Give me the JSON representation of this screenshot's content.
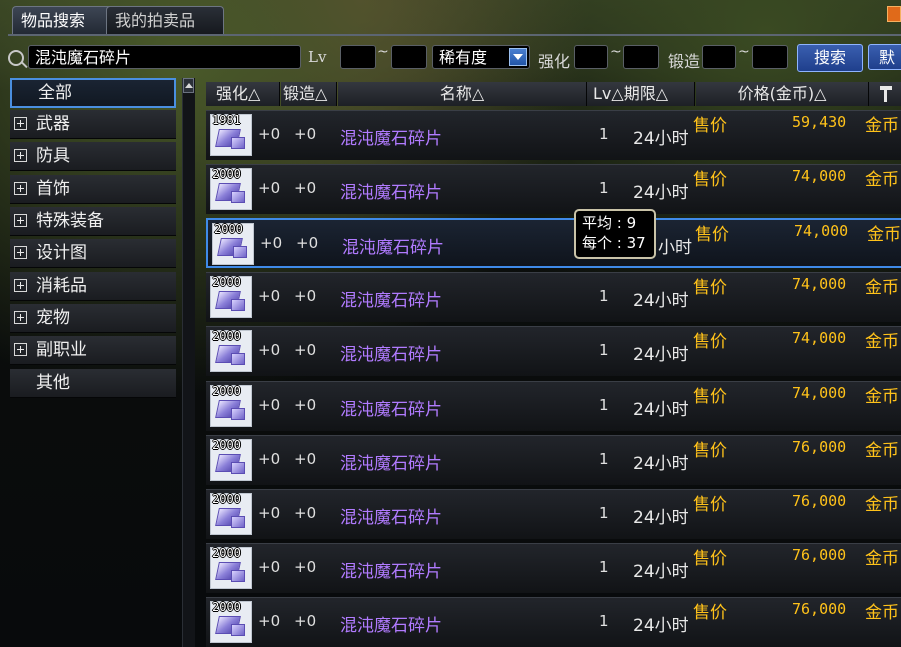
{
  "tabs": {
    "search": "物品搜索",
    "mine": "我的拍卖品"
  },
  "search": {
    "query": "混沌魔石碎片",
    "lv_label": "Lv",
    "tilde": "~",
    "rarity_selected": "稀有度",
    "enhance_label": "强化",
    "forge_label": "锻造",
    "search_button": "搜索",
    "default_button": "默"
  },
  "sidebar": {
    "items": [
      {
        "label": "全部"
      },
      {
        "label": "武器"
      },
      {
        "label": "防具"
      },
      {
        "label": "首饰"
      },
      {
        "label": "特殊装备"
      },
      {
        "label": "设计图"
      },
      {
        "label": "消耗品"
      },
      {
        "label": "宠物"
      },
      {
        "label": "副职业"
      },
      {
        "label": "其他"
      }
    ]
  },
  "table": {
    "headers": {
      "enhance": "强化△",
      "forge": "锻造△",
      "name": "名称△",
      "lv_period": "Lv△期限△",
      "price": "价格(金币)△"
    },
    "rows": [
      {
        "qty": "1981",
        "enhance": "+0",
        "forge": "+0",
        "name": "混沌魔石碎片",
        "lv": "1",
        "period": "24小时",
        "sell": "售价",
        "price": "59,430",
        "currency": "金币"
      },
      {
        "qty": "2000",
        "enhance": "+0",
        "forge": "+0",
        "name": "混沌魔石碎片",
        "lv": "1",
        "period": "24小时",
        "sell": "售价",
        "price": "74,000",
        "currency": "金币"
      },
      {
        "qty": "2000",
        "enhance": "+0",
        "forge": "+0",
        "name": "混沌魔石碎片",
        "lv": "",
        "period": "小时",
        "sell": "售价",
        "price": "74,000",
        "currency": "金币"
      },
      {
        "qty": "2000",
        "enhance": "+0",
        "forge": "+0",
        "name": "混沌魔石碎片",
        "lv": "1",
        "period": "24小时",
        "sell": "售价",
        "price": "74,000",
        "currency": "金币"
      },
      {
        "qty": "2000",
        "enhance": "+0",
        "forge": "+0",
        "name": "混沌魔石碎片",
        "lv": "1",
        "period": "24小时",
        "sell": "售价",
        "price": "74,000",
        "currency": "金币"
      },
      {
        "qty": "2000",
        "enhance": "+0",
        "forge": "+0",
        "name": "混沌魔石碎片",
        "lv": "1",
        "period": "24小时",
        "sell": "售价",
        "price": "74,000",
        "currency": "金币"
      },
      {
        "qty": "2000",
        "enhance": "+0",
        "forge": "+0",
        "name": "混沌魔石碎片",
        "lv": "1",
        "period": "24小时",
        "sell": "售价",
        "price": "76,000",
        "currency": "金币"
      },
      {
        "qty": "2000",
        "enhance": "+0",
        "forge": "+0",
        "name": "混沌魔石碎片",
        "lv": "1",
        "period": "24小时",
        "sell": "售价",
        "price": "76,000",
        "currency": "金币"
      },
      {
        "qty": "2000",
        "enhance": "+0",
        "forge": "+0",
        "name": "混沌魔石碎片",
        "lv": "1",
        "period": "24小时",
        "sell": "售价",
        "price": "76,000",
        "currency": "金币"
      },
      {
        "qty": "2000",
        "enhance": "+0",
        "forge": "+0",
        "name": "混沌魔石碎片",
        "lv": "1",
        "period": "24小时",
        "sell": "售价",
        "price": "76,000",
        "currency": "金币"
      }
    ]
  },
  "tooltip": {
    "line1": "平均 : 9",
    "line2": "每个 : 37"
  },
  "colors": {
    "accent": "#3f8ae8",
    "gold": "#ffc21a",
    "item_name": "#b17bff"
  }
}
